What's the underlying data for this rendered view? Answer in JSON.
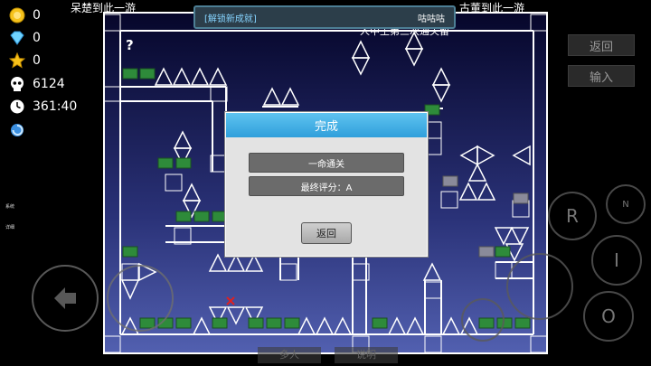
{
  "hud": {
    "coins": "0",
    "gems": "0",
    "stars": "0",
    "deaths": "6124",
    "time": "361:40"
  },
  "level": {
    "top_left_text": "呆楚到此一游",
    "top_right_text": "古董到此一游",
    "sub_text": "人中王第三次通关留",
    "question_mark": "?"
  },
  "notification": {
    "left": "[解锁新成就]",
    "right": "咕咕咕"
  },
  "dialog": {
    "title": "完成",
    "line1": "一命通关",
    "line2": "最终评分：A",
    "back": "返回"
  },
  "side_buttons": {
    "back": "返回",
    "input": "输入"
  },
  "left_labels": {
    "system": "系统",
    "detail": "详细"
  },
  "controls": {
    "r": "R",
    "n": "N",
    "i": "I",
    "o": "O"
  },
  "bottom_tabs": {
    "left": "多人",
    "right": "说明"
  },
  "colors": {
    "sign_green": "#2e8b3a",
    "accent_blue": "#2f9fdb",
    "toast_border": "#4d7f95",
    "spike": "#ffffff",
    "bg_top": "#0a0a2e",
    "bg_bottom": "#4e5aa8"
  }
}
